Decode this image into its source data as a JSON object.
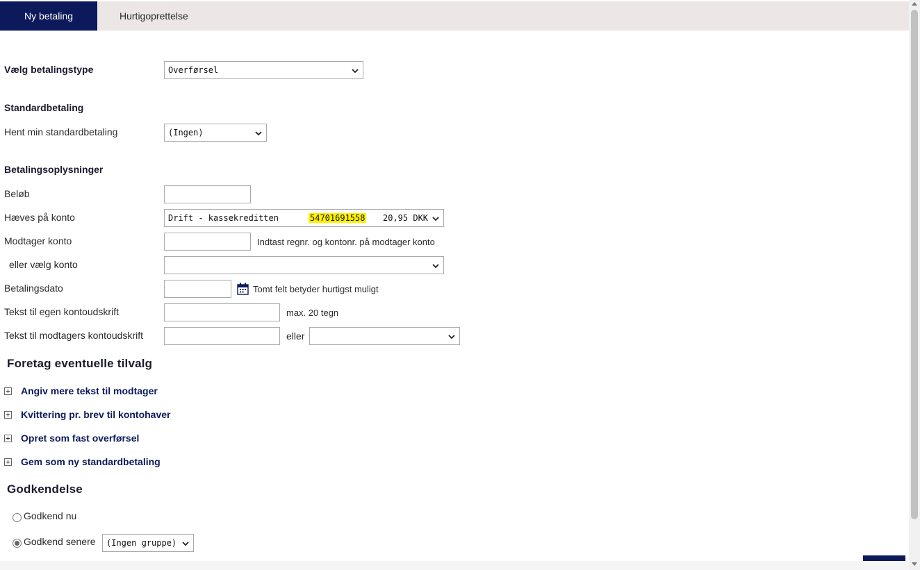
{
  "tabs": [
    {
      "label": "Ny betaling",
      "active": true
    },
    {
      "label": "Hurtigoprettelse",
      "active": false
    }
  ],
  "payment_type": {
    "label": "Vælg betalingstype",
    "value": "Overførsel"
  },
  "standard": {
    "heading": "Standardbetaling",
    "label": "Hent min standardbetaling",
    "value": "(Ingen)"
  },
  "info": {
    "heading": "Betalingsoplysninger",
    "amount_label": "Beløb",
    "amount_value": "",
    "debit_label": "Hæves på konto",
    "debit_account_name": "Drift - kassekreditten",
    "debit_account_number": "54701691558",
    "debit_balance": "20,95 DKK",
    "receiver_label": "Modtager konto",
    "receiver_value": "",
    "receiver_hint": "Indtast regnr. og kontonr. på modtager konto",
    "or_select_label": "eller vælg konto",
    "or_select_value": "",
    "date_label": "Betalingsdato",
    "date_value": "",
    "date_hint": "Tomt felt betyder hurtigst muligt",
    "own_text_label": "Tekst til egen kontoudskrift",
    "own_text_value": "",
    "own_text_hint": "max. 20 tegn",
    "receiver_text_label": "Tekst til modtagers kontoudskrift",
    "receiver_text_value": "",
    "receiver_text_or": "eller",
    "receiver_text_select": ""
  },
  "options": {
    "heading": "Foretag eventuelle tilvalg",
    "items": [
      "Angiv mere tekst til modtager",
      "Kvittering pr. brev til kontohaver",
      "Opret som fast overførsel",
      "Gem som ny standardbetaling"
    ]
  },
  "approval": {
    "heading": "Godkendelse",
    "now_label": "Godkend nu",
    "later_label": "Godkend senere",
    "group_value": "(Ingen gruppe)",
    "selected": "later"
  },
  "colors": {
    "brand": "#0c1a5c",
    "highlight": "#fff200",
    "tabbar": "#ece7e5"
  }
}
